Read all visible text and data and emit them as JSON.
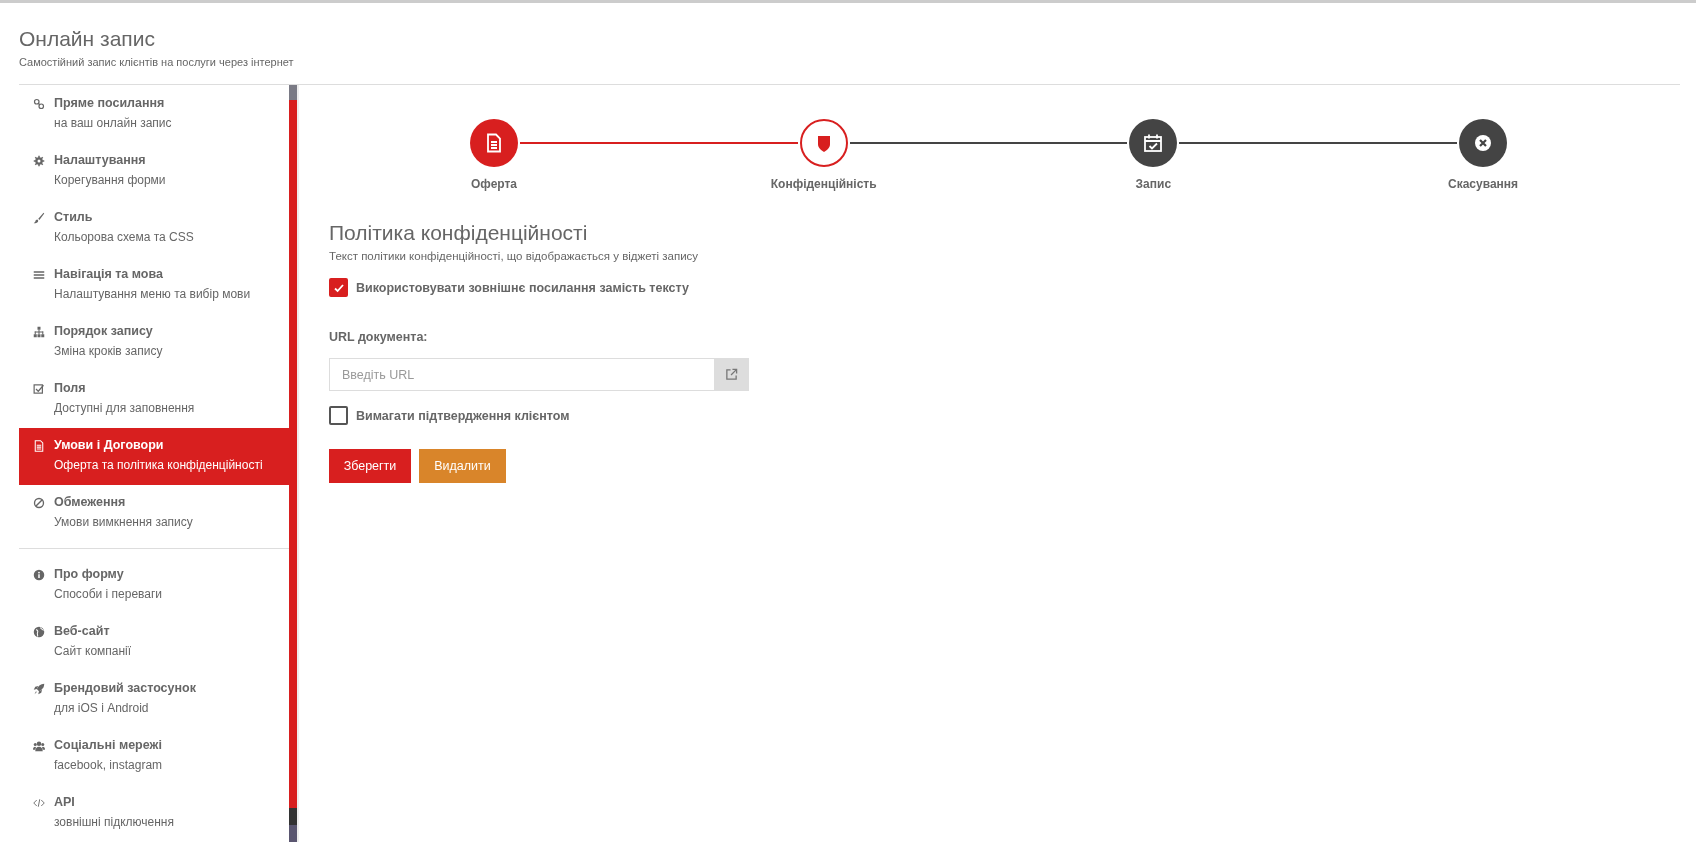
{
  "header": {
    "title": "Онлайн запис",
    "subtitle": "Самостійний запис клієнтів на послуги через інтернет"
  },
  "sidebar": {
    "items": [
      {
        "title": "Пряме посилання",
        "subtitle": "на ваш онлайн запис",
        "selected": false
      },
      {
        "title": "Налаштування",
        "subtitle": "Корегування форми",
        "selected": false
      },
      {
        "title": "Стиль",
        "subtitle": "Кольорова схема та CSS",
        "selected": false
      },
      {
        "title": "Навігація та мова",
        "subtitle": "Налаштування меню та вибір мови",
        "selected": false
      },
      {
        "title": "Порядок запису",
        "subtitle": "Зміна кроків запису",
        "selected": false
      },
      {
        "title": "Поля",
        "subtitle": "Доступні для заповнення",
        "selected": false
      },
      {
        "title": "Умови і Договори",
        "subtitle": "Оферта та політика конфіденційності",
        "selected": true
      },
      {
        "title": "Обмеження",
        "subtitle": "Умови вимкнення запису",
        "selected": false
      }
    ],
    "extra_items": [
      {
        "title": "Про форму",
        "subtitle": "Способи і переваги",
        "selected": false
      },
      {
        "title": "Веб-сайт",
        "subtitle": "Сайт компанії",
        "selected": false
      },
      {
        "title": "Брендовий застосунок",
        "subtitle": "для iOS і Android",
        "selected": false
      },
      {
        "title": "Соціальні мережі",
        "subtitle": "facebook, instagram",
        "selected": false
      },
      {
        "title": "API",
        "subtitle": "зовнішні підключення",
        "selected": false
      }
    ]
  },
  "steps": [
    {
      "label": "Оферта",
      "done": true,
      "selected": false
    },
    {
      "label": "Конфіденційність",
      "done": false,
      "selected": true
    },
    {
      "label": "Запис",
      "done": false,
      "selected": false
    },
    {
      "label": "Скасування",
      "done": false,
      "selected": false
    }
  ],
  "section": {
    "title": "Політика конфіденційності",
    "description": "Текст політики конфіденційності, що відображається у віджеті запису"
  },
  "use_link": {
    "label": "Використовувати зовнішнє посилання замість тексту",
    "checked": true
  },
  "url_field": {
    "label": "URL документа:",
    "placeholder": "Введіть URL"
  },
  "require_confirm": {
    "label": "Вимагати підтвердження клієнтом",
    "checked": false
  },
  "buttons": [
    {
      "label": "Зберегти",
      "kind": "primary"
    },
    {
      "label": "Видалити",
      "kind": "warning"
    }
  ]
}
